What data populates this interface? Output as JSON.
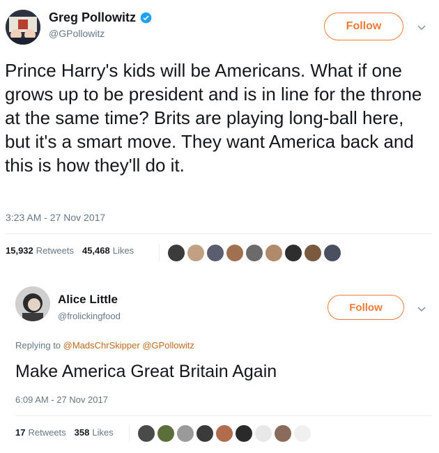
{
  "tweet1": {
    "name": "Greg Pollowitz",
    "handle": "@GPollowitz",
    "follow_label": "Follow",
    "verified": true,
    "text": "Prince Harry's kids will be Americans. What if one grows up to be president and is in line for the throne at the same time? Brits are playing long-ball here, but it's a smart move. They want America back and this is how they'll do it.",
    "timestamp": "3:23 AM - 27 Nov 2017",
    "retweets_count": "15,932",
    "retweets_label": "Retweets",
    "likes_count": "45,468",
    "likes_label": "Likes"
  },
  "tweet2": {
    "name": "Alice Little",
    "handle": "@frolickingfood",
    "follow_label": "Follow",
    "replying_prefix": "Replying to",
    "reply_to_1": "@MadsChrSkipper",
    "reply_to_2": "@GPollowitz",
    "text": "Make America Great Britain Again",
    "timestamp": "6:09 AM - 27 Nov 2017",
    "retweets_count": "17",
    "retweets_label": "Retweets",
    "likes_count": "358",
    "likes_label": "Likes"
  },
  "colors": {
    "accent": "#f07b35",
    "verified": "#1da1f2",
    "muted": "#657786"
  }
}
